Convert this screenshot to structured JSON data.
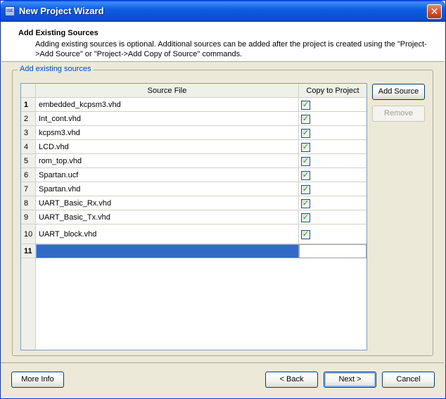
{
  "window": {
    "title": "New Project Wizard",
    "app_icon_text": "ISE",
    "close_glyph": "✕"
  },
  "header": {
    "title": "Add Existing Sources",
    "description": "Adding existing sources is optional. Additional sources can be added after the project is created using the \"Project->Add Source\" or \"Project->Add Copy of Source\" commands."
  },
  "group": {
    "label": "Add existing sources"
  },
  "table": {
    "columns": [
      "Source File",
      "Copy to Project"
    ],
    "rows": [
      {
        "num": "1",
        "file": "embedded_kcpsm3.vhd",
        "copy": true
      },
      {
        "num": "2",
        "file": "Int_cont.vhd",
        "copy": true
      },
      {
        "num": "3",
        "file": "kcpsm3.vhd",
        "copy": true
      },
      {
        "num": "4",
        "file": "LCD.vhd",
        "copy": true
      },
      {
        "num": "5",
        "file": "rom_top.vhd",
        "copy": true
      },
      {
        "num": "6",
        "file": "Spartan.ucf",
        "copy": true
      },
      {
        "num": "7",
        "file": "Spartan.vhd",
        "copy": true
      },
      {
        "num": "8",
        "file": "UART_Basic_Rx.vhd",
        "copy": true
      },
      {
        "num": "9",
        "file": "UART_Basic_Tx.vhd",
        "copy": true
      },
      {
        "num": "10",
        "file": "UART_block.vhd",
        "copy": true
      },
      {
        "num": "11",
        "file": "",
        "copy": false
      }
    ],
    "check_glyph": "✓"
  },
  "side_buttons": {
    "add_source": "Add Source",
    "remove": "Remove"
  },
  "footer": {
    "more_info": "More Info",
    "back": "< Back",
    "next": "Next >",
    "cancel": "Cancel"
  }
}
